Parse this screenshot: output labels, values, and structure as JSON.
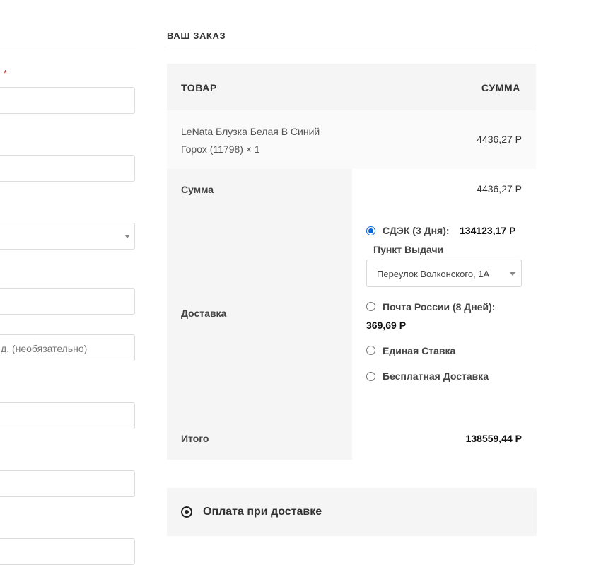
{
  "billing": {
    "required_mark": "*",
    "optional_placeholder": "д. (необязательно)"
  },
  "order": {
    "title": "ВАШ ЗАКАЗ",
    "columns": {
      "product": "ТОВАР",
      "total": "СУММА"
    },
    "item": {
      "name": "LeNata Блузка Белая В Синий Горох (11798)  × 1",
      "price": "4436,27 Р"
    },
    "subtotal": {
      "label": "Сумма",
      "value": "4436,27 Р"
    },
    "shipping": {
      "label": "Доставка",
      "options": [
        {
          "label": "СДЭК (3 Дня):",
          "price": "134123,17 Р",
          "selected": true
        },
        {
          "label": "Почта России (8 Дней):",
          "price": "369,69 Р",
          "selected": false
        },
        {
          "label": "Единая Ставка",
          "selected": false
        },
        {
          "label": "Бесплатная Доставка",
          "selected": false
        }
      ],
      "pickup_label": "Пункт Выдачи",
      "pickup_value": "Переулок Волконского, 1А"
    },
    "total": {
      "label": "Итого",
      "value": "138559,44 Р"
    }
  },
  "payment": {
    "method_label": "Оплата при доставке"
  }
}
